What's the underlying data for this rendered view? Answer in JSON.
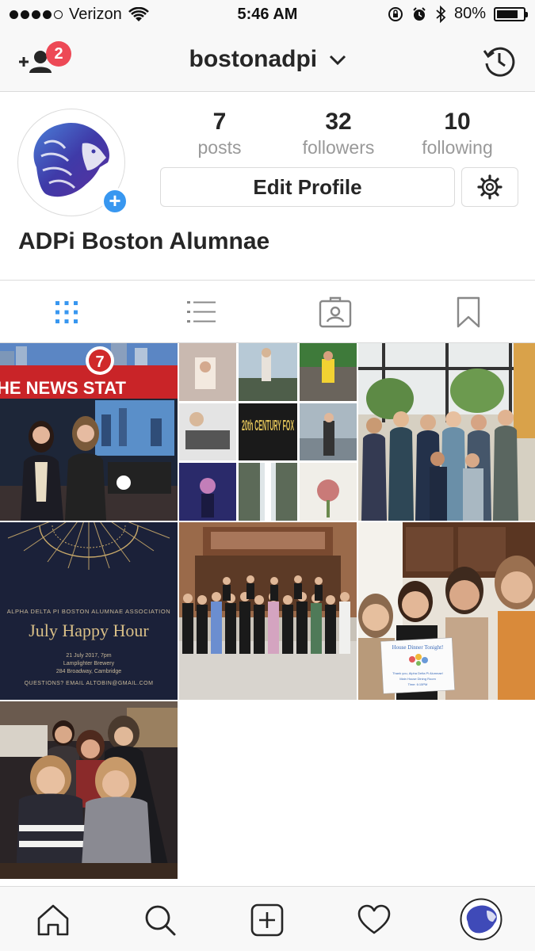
{
  "status_bar": {
    "carrier": "Verizon",
    "time": "5:46 AM",
    "battery": "80%",
    "battery_level": 0.8
  },
  "navbar": {
    "username": "bostonadpi",
    "notification_count": "2",
    "icons": [
      "add-person-icon",
      "chevron-down-icon",
      "history-icon"
    ]
  },
  "profile": {
    "display_name": "ADPi Boston Alumnae",
    "stats": {
      "posts": {
        "value": "7",
        "label": "posts"
      },
      "followers": {
        "value": "32",
        "label": "followers"
      },
      "following": {
        "value": "10",
        "label": "following"
      }
    },
    "edit_label": "Edit Profile"
  },
  "tabs": [
    "grid-view-icon",
    "list-view-icon",
    "tagged-photos-icon",
    "saved-bookmark-icon"
  ],
  "posts": [
    {
      "name": "post-news-station",
      "overlay_text": "HE NEWS STAT",
      "badge": "7"
    },
    {
      "name": "post-collage",
      "overlay_text": "20th CENTURY FOX"
    },
    {
      "name": "post-group-window"
    },
    {
      "name": "post-july-happy-hour",
      "org": "ALPHA DELTA PI BOSTON ALUMNAE ASSOCIATION",
      "headline": "July Happy Hour",
      "date": "21 July 2017, 7pm",
      "venue": "Lamplighter Brewery",
      "address": "284 Broadway, Cambridge",
      "contact": "QUESTIONS? EMAIL ALTOBIN@GMAIL.COM"
    },
    {
      "name": "post-group-fireplace"
    },
    {
      "name": "post-house-dinner",
      "sign_title": "House Dinner Tonight!",
      "sign_line1": "Thank you, Alpha Delta Pi Alumnae!",
      "sign_line2": "Main House Dining Room",
      "sign_line3": "Time: 6:15PM"
    },
    {
      "name": "post-bar-friends"
    }
  ],
  "bottom_nav": [
    "home-icon",
    "search-icon",
    "new-post-icon",
    "activity-heart-icon",
    "profile-avatar-icon"
  ],
  "colors": {
    "accent_blue": "#3897f0",
    "badge_red": "#ed4956",
    "text_dark": "#262626",
    "text_muted": "#999999",
    "border": "#dbdbdb"
  }
}
